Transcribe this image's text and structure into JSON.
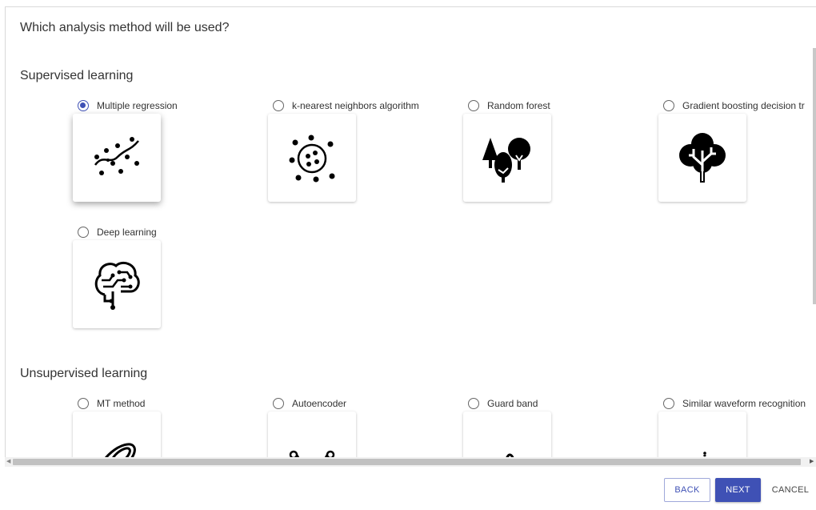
{
  "dialog": {
    "question": "Which analysis method will be used?"
  },
  "supervised": {
    "title": "Supervised learning",
    "options": [
      {
        "label": "Multiple regression",
        "icon": "scatter-regression-icon",
        "selected": true
      },
      {
        "label": "k-nearest neighbors algorithm",
        "icon": "knn-cluster-icon",
        "selected": false
      },
      {
        "label": "Random forest",
        "icon": "trees-icon",
        "selected": false
      },
      {
        "label": "Gradient boosting decision tr",
        "icon": "decision-tree-icon",
        "selected": false
      },
      {
        "label": "Deep learning",
        "icon": "circuit-brain-icon",
        "selected": false
      }
    ]
  },
  "unsupervised": {
    "title": "Unsupervised learning",
    "options": [
      {
        "label": "MT method",
        "icon": "ellipse-distribution-icon",
        "selected": false
      },
      {
        "label": "Autoencoder",
        "icon": "autoencoder-network-icon",
        "selected": false
      },
      {
        "label": "Guard band",
        "icon": "guard-band-icon",
        "selected": false
      },
      {
        "label": "Similar waveform recognition",
        "icon": "waveform-icon",
        "selected": false
      }
    ]
  },
  "footer": {
    "back_label": "BACK",
    "next_label": "NEXT",
    "cancel_label": "CANCEL"
  },
  "colors": {
    "accent": "#3f51b5",
    "text": "#333333"
  }
}
